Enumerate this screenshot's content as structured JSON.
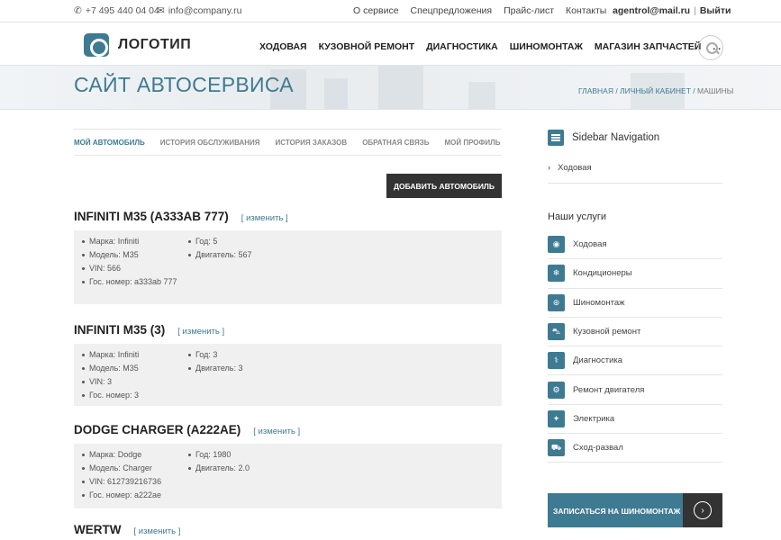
{
  "topbar": {
    "phone": "+7 495 440 04 04",
    "email": "info@company.ru",
    "links": [
      "О сервисе",
      "Спецпредложения",
      "Прайс-лист",
      "Контакты"
    ],
    "user_email": "agentrol@mail.ru",
    "logout": "Выйти"
  },
  "header": {
    "logo_text": "ЛОГОТИП",
    "nav": [
      "ХОДОВАЯ",
      "КУЗОВНОЙ РЕМОНТ",
      "ДИАГНОСТИКА",
      "ШИНОМОНТАЖ",
      "МАГАЗИН ЗАПЧАСТЕЙ",
      "..."
    ]
  },
  "banner": {
    "title": "САЙТ АВТОСЕРВИСА",
    "breadcrumb": [
      "ГЛАВНАЯ",
      "ЛИЧНЫЙ КАБИНЕТ",
      "МАШИНЫ"
    ]
  },
  "tabs": [
    "МОЙ АВТОМОБИЛЬ",
    "ИСТОРИЯ ОБСЛУЖИВАНИЯ",
    "ИСТОРИЯ ЗАКАЗОВ",
    "ОБРАТНАЯ СВЯЗЬ",
    "МОЙ ПРОФИЛЬ"
  ],
  "add_button": "ДОБАВИТЬ АВТОМОБИЛЬ",
  "edit_label": "[ изменить ]",
  "cars": [
    {
      "name": "INFINITI M35 (А333АВ 777)",
      "left": [
        "Марка: Infiniti",
        "Модель: M35",
        "VIN: 566",
        "Гос. номер: а333ab 777"
      ],
      "right": [
        "Год: 5",
        "Двигатель: 567"
      ]
    },
    {
      "name": "INFINITI M35 (3)",
      "left": [
        "Марка: Infiniti",
        "Модель: M35",
        "VIN: 3",
        "Гос. номер: 3"
      ],
      "right": [
        "Год: 3",
        "Двигатель: 3"
      ]
    },
    {
      "name": "DODGE CHARGER (А222АЕ)",
      "left": [
        "Марка: Dodge",
        "Модель: Charger",
        "VIN: 612739216736",
        "Гос. номер: а222ае"
      ],
      "right": [
        "Год: 1980",
        "Двигатель: 2.0"
      ]
    },
    {
      "name": "WERTW",
      "left": [],
      "right": []
    }
  ],
  "sidebar": {
    "nav_title": "Sidebar Navigation",
    "nav_item": "Ходовая",
    "services_title": "Наши услуги",
    "services": [
      {
        "label": "Ходовая",
        "icon": "chassis-icon",
        "glyph": "◉"
      },
      {
        "label": "Кондиционеры",
        "icon": "air-conditioner-icon",
        "glyph": "❄"
      },
      {
        "label": "Шиномонтаж",
        "icon": "tire-icon",
        "glyph": "⊛"
      },
      {
        "label": "Кузовной ремонт",
        "icon": "car-body-icon",
        "glyph": "⛍"
      },
      {
        "label": "Диагностика",
        "icon": "stethoscope-icon",
        "glyph": "⚕"
      },
      {
        "label": "Ремонт двигателя",
        "icon": "engine-icon",
        "glyph": "⚙"
      },
      {
        "label": "Электрика",
        "icon": "light-bulb-icon",
        "glyph": "✦"
      },
      {
        "label": "Сход-развал",
        "icon": "alignment-icon",
        "glyph": "⛟"
      }
    ],
    "cta_label": "ЗАПИСАТЬСЯ НА ШИНОМОНТАЖ"
  },
  "colors": {
    "accent": "#3f7a93",
    "dark": "#333333",
    "panel": "#f0f0f0"
  }
}
